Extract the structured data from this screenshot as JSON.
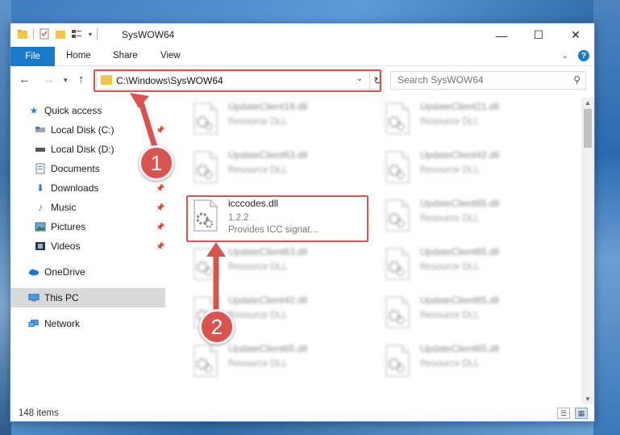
{
  "window": {
    "title": "SysWOW64"
  },
  "ribbon": {
    "file": "File",
    "tabs": [
      "Home",
      "Share",
      "View"
    ]
  },
  "address": {
    "path": "C:\\Windows\\SysWOW64"
  },
  "search": {
    "placeholder": "Search SysWOW64"
  },
  "sidebar": {
    "items": [
      {
        "label": "Quick access"
      },
      {
        "label": "Local Disk (C:)"
      },
      {
        "label": "Local Disk (D:)"
      },
      {
        "label": "Documents"
      },
      {
        "label": "Downloads"
      },
      {
        "label": "Music"
      },
      {
        "label": "Pictures"
      },
      {
        "label": "Videos"
      },
      {
        "label": "OneDrive"
      },
      {
        "label": "This PC"
      },
      {
        "label": "Network"
      }
    ]
  },
  "files": {
    "focused": {
      "name": "icccodes.dll",
      "version": "1.2.2",
      "desc": "Provides ICC signat..."
    },
    "blurred": [
      {
        "name": "UpdateClient19.dll",
        "desc": "Resource DLL"
      },
      {
        "name": "UpdateClient21.dll",
        "desc": "Resource DLL"
      },
      {
        "name": "UpdateClient63.dll",
        "desc": "Resource DLL"
      },
      {
        "name": "UpdateClient42.dll",
        "desc": "Resource DLL"
      },
      {
        "name": "UpdateClient65.dll",
        "desc": "Resource DLL"
      },
      {
        "name": "UpdateClient63.dll",
        "desc": "Resource DLL"
      },
      {
        "name": "UpdateClient65.dll",
        "desc": "Resource DLL"
      },
      {
        "name": "UpdateClient42.dll",
        "desc": "Resource DLL"
      },
      {
        "name": "UpdateClient65.dll",
        "desc": "Resource DLL"
      },
      {
        "name": "UpdateClient65.dll",
        "desc": "Resource DLL"
      },
      {
        "name": "UpdateClient65.dll",
        "desc": "Resource DLL"
      }
    ]
  },
  "status": {
    "count": "148 items"
  },
  "annotations": {
    "step1": "1",
    "step2": "2"
  },
  "colors": {
    "accent": "#1979ca",
    "highlight": "#d9534f"
  }
}
